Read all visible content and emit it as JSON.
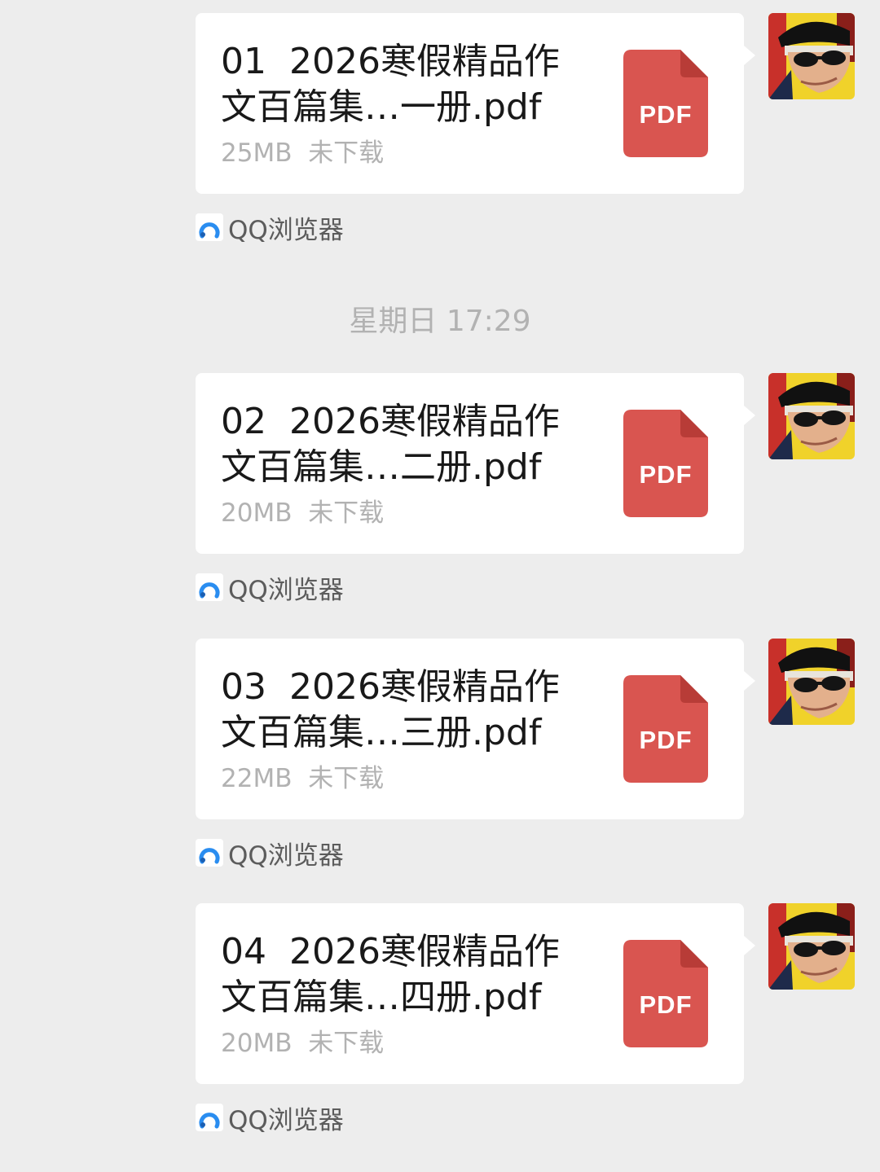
{
  "timestamp": "星期日 17:29",
  "messages": [
    {
      "name_line1": "01  2026寒假精品作",
      "name_line2": "文百篇集…一册.pdf",
      "size": "25MB",
      "status": "未下载",
      "file_type": "PDF",
      "source": "QQ浏览器"
    },
    {
      "name_line1": "02  2026寒假精品作",
      "name_line2": "文百篇集…二册.pdf",
      "size": "20MB",
      "status": "未下载",
      "file_type": "PDF",
      "source": "QQ浏览器"
    },
    {
      "name_line1": "03  2026寒假精品作",
      "name_line2": "文百篇集…三册.pdf",
      "size": "22MB",
      "status": "未下载",
      "file_type": "PDF",
      "source": "QQ浏览器"
    },
    {
      "name_line1": "04  2026寒假精品作",
      "name_line2": "文百篇集…四册.pdf",
      "size": "20MB",
      "status": "未下载",
      "file_type": "PDF",
      "source": "QQ浏览器"
    }
  ],
  "icons": {
    "file": "pdf-file-icon",
    "source": "qq-browser-icon",
    "avatar": "user-avatar"
  },
  "colors": {
    "background": "#ededed",
    "bubble": "#ffffff",
    "pdf_red": "#d95550",
    "meta_text": "#b2b2b2",
    "qq_blue": "#2a8df0"
  }
}
